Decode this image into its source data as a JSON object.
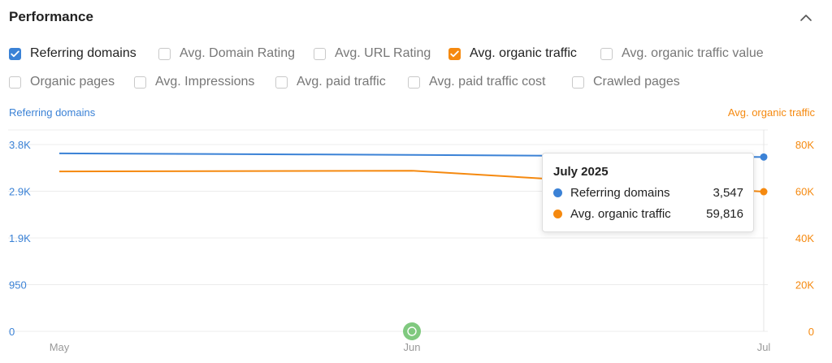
{
  "panel": {
    "title": "Performance"
  },
  "metrics": [
    {
      "label": "Referring domains",
      "checked": true,
      "color": "#3b82d6"
    },
    {
      "label": "Avg. Domain Rating",
      "checked": false
    },
    {
      "label": "Avg. URL Rating",
      "checked": false
    },
    {
      "label": "Avg. organic traffic",
      "checked": true,
      "color": "#f5890f"
    },
    {
      "label": "Avg. organic traffic value",
      "checked": false
    },
    {
      "label": "Organic pages",
      "checked": false
    },
    {
      "label": "Avg. Impressions",
      "checked": false
    },
    {
      "label": "Avg. paid traffic",
      "checked": false
    },
    {
      "label": "Avg. paid traffic cost",
      "checked": false
    },
    {
      "label": "Crawled pages",
      "checked": false
    }
  ],
  "tooltip": {
    "title": "July 2025",
    "rows": [
      {
        "name": "Referring domains",
        "value": "3,547",
        "color": "#3b82d6"
      },
      {
        "name": "Avg. organic traffic",
        "value": "59,816",
        "color": "#f5890f"
      }
    ]
  },
  "annotation": {
    "icon": "google-update-marker-icon",
    "color": "#6abf69",
    "at": "Jun"
  },
  "chart_data": {
    "type": "line",
    "x": [
      "May",
      "Jun",
      "Jul"
    ],
    "left_axis": {
      "title": "Referring domains",
      "ticks": [
        "0",
        "950",
        "1.9K",
        "2.9K",
        "3.8K"
      ],
      "range": [
        0,
        3800
      ],
      "color": "#3b82d6"
    },
    "right_axis": {
      "title": "Avg. organic traffic",
      "ticks": [
        "0",
        "20K",
        "40K",
        "60K",
        "80K"
      ],
      "range": [
        0,
        80000
      ],
      "color": "#f5890f"
    },
    "series": [
      {
        "name": "Referring domains",
        "axis": "left",
        "color": "#3b82d6",
        "values": [
          3620,
          3590,
          3547
        ]
      },
      {
        "name": "Avg. organic traffic",
        "axis": "right",
        "color": "#f5890f",
        "values": [
          68500,
          68800,
          59816
        ]
      }
    ],
    "grid": true,
    "tooltip_at": "Jul"
  }
}
